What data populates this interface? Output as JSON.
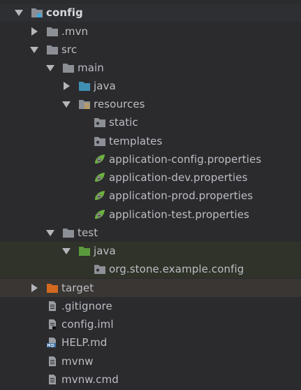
{
  "tree": {
    "root": {
      "label": "config",
      "expanded": true
    },
    "mvn": {
      "label": ".mvn",
      "expanded": false
    },
    "src": {
      "label": "src",
      "expanded": true
    },
    "main": {
      "label": "main",
      "expanded": true
    },
    "java_main": {
      "label": "java",
      "expanded": false
    },
    "resources": {
      "label": "resources",
      "expanded": true
    },
    "static": {
      "label": "static"
    },
    "templates": {
      "label": "templates"
    },
    "app_config": {
      "label": "application-config.properties"
    },
    "app_dev": {
      "label": "application-dev.properties"
    },
    "app_prod": {
      "label": "application-prod.properties"
    },
    "app_test": {
      "label": "application-test.properties"
    },
    "test": {
      "label": "test",
      "expanded": true
    },
    "java_test": {
      "label": "java",
      "expanded": true
    },
    "test_package": {
      "label": "org.stone.example.config"
    },
    "target": {
      "label": "target",
      "expanded": false
    },
    "gitignore": {
      "label": ".gitignore"
    },
    "iml": {
      "label": "config.iml"
    },
    "help": {
      "label": "HELP.md"
    },
    "mvnw": {
      "label": "mvnw"
    },
    "mvnw_cmd": {
      "label": "mvnw.cmd"
    }
  },
  "colors": {
    "folder": "#8c9096",
    "source_folder": "#3f8fb3",
    "test_folder": "#5b9a3c",
    "excluded_folder": "#d2691e",
    "spring_leaf": "#6db33f"
  }
}
